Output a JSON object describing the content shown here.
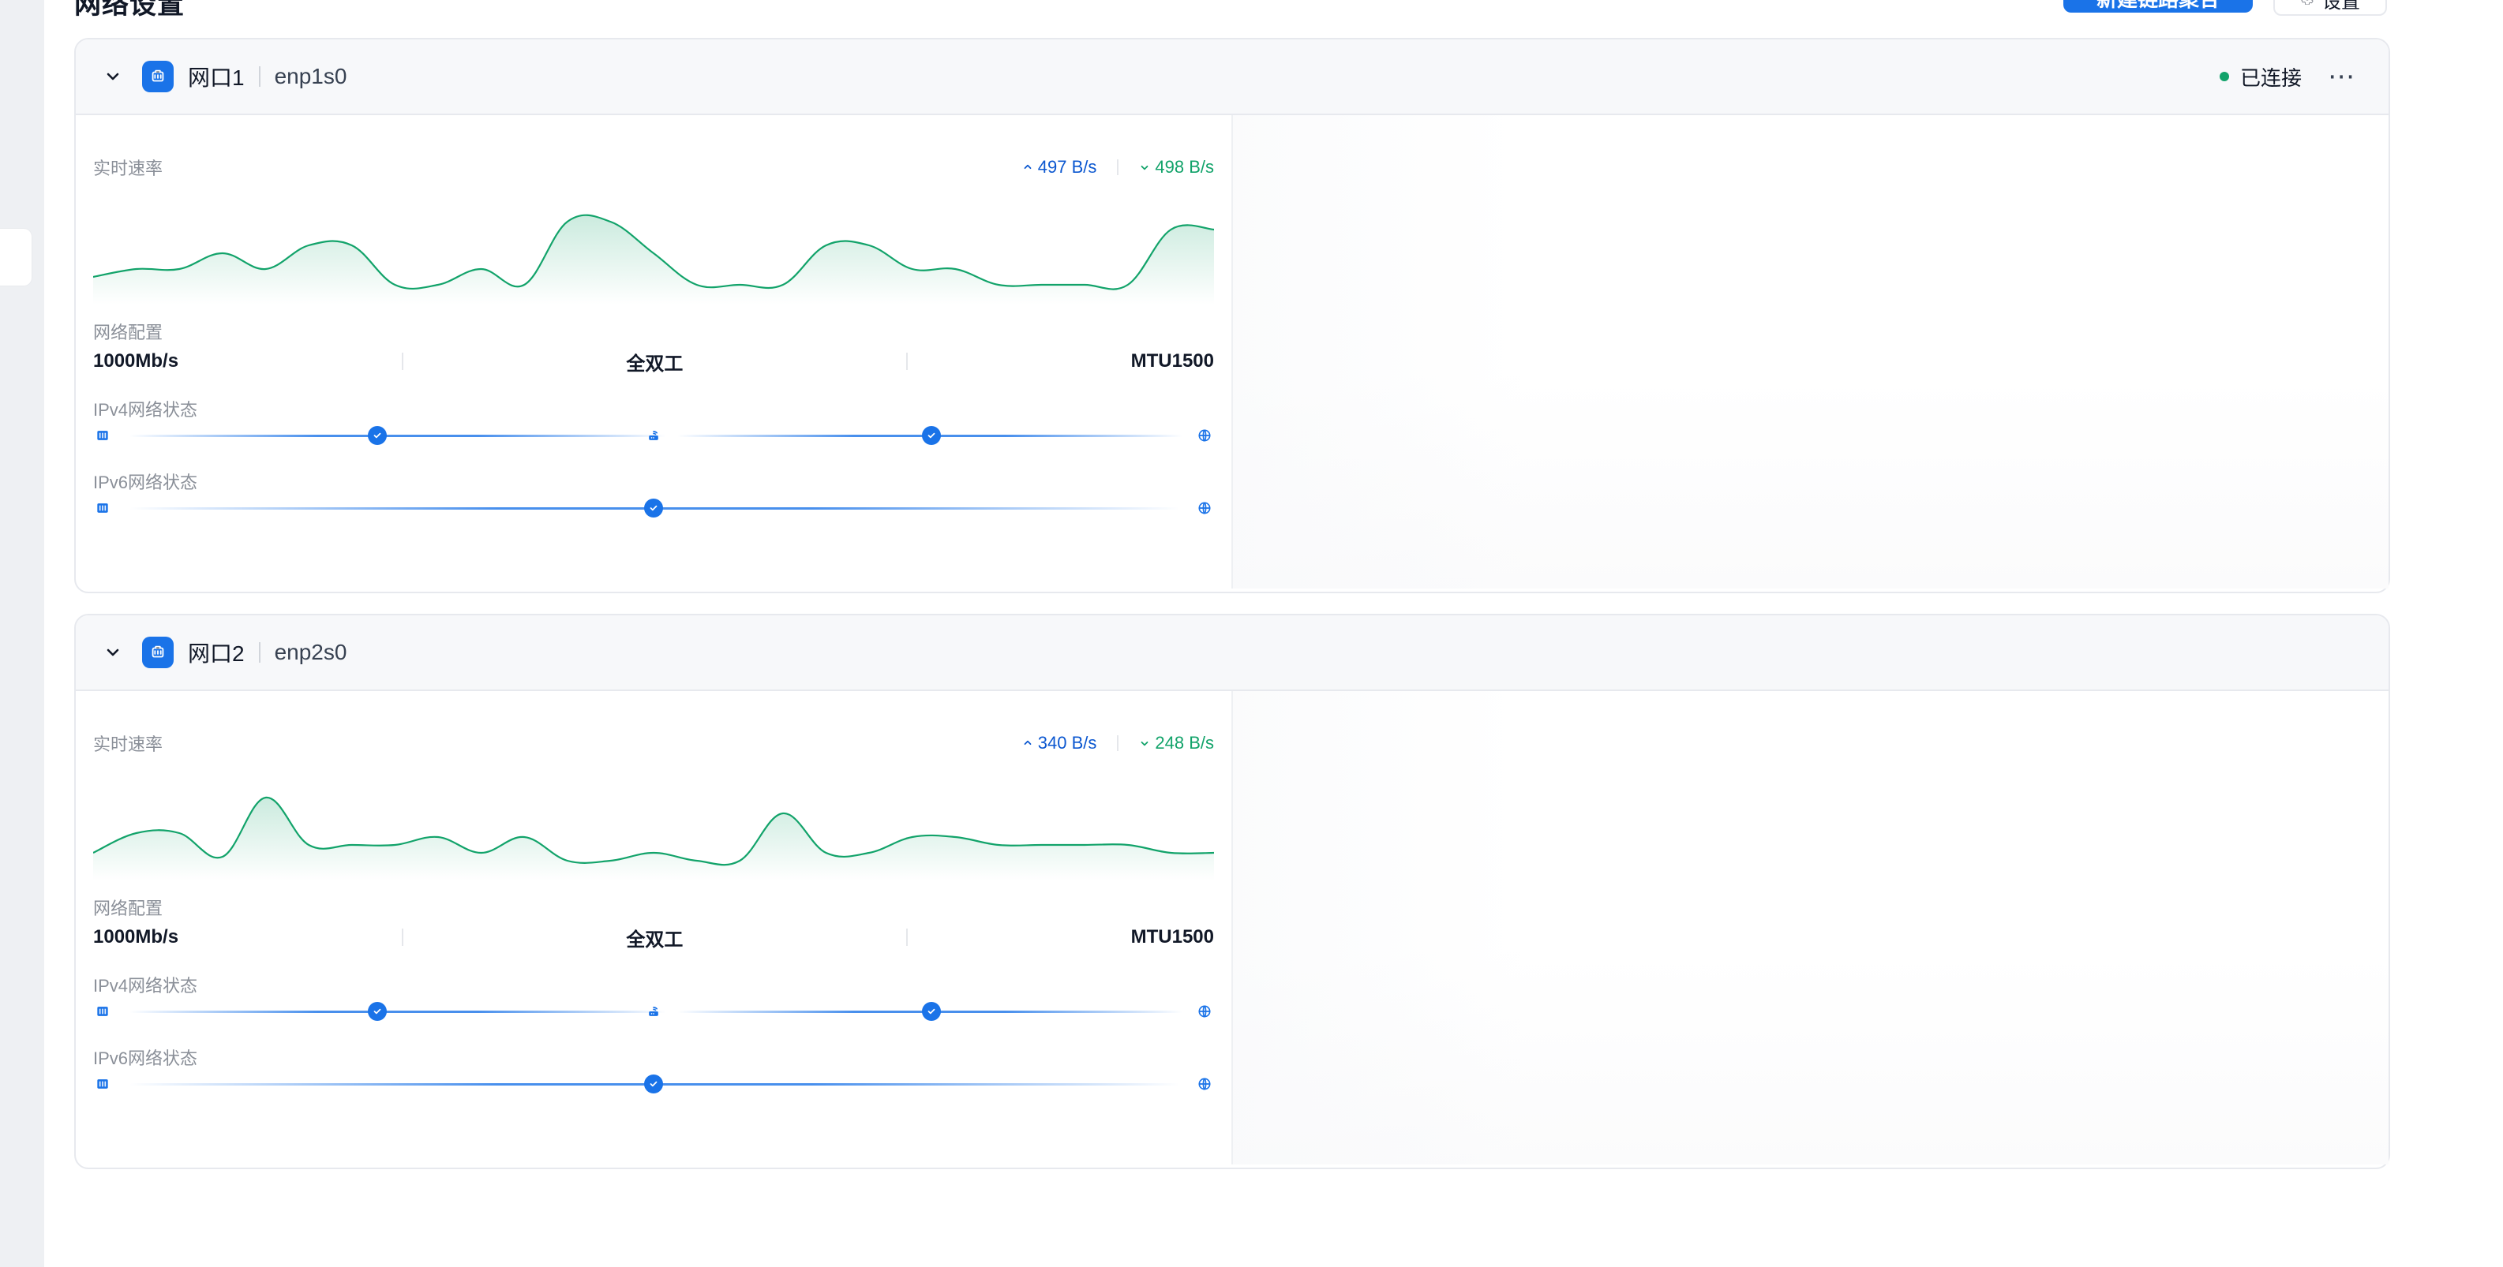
{
  "header": {
    "page_title": "网络设置",
    "primary_button": "新建链路聚合",
    "secondary_button": "设置"
  },
  "ports": [
    {
      "name": "网口1",
      "device": "enp1s0",
      "status": "已连接",
      "realtime_label": "实时速率",
      "up_speed": "497 B/s",
      "down_speed": "498 B/s",
      "net_config_label": "网络配置",
      "speed_mode": "1000Mb/s",
      "duplex": "全双工",
      "mtu": "MTU1500",
      "ipv4_label": "IPv4网络状态",
      "ipv6_label": "IPv6网络状态",
      "chart_series": [
        0.25,
        0.35,
        0.35,
        0.55,
        0.35,
        0.65,
        0.65,
        0.15,
        0.15,
        0.35,
        0.15,
        0.95,
        0.95,
        0.55,
        0.15,
        0.15,
        0.15,
        0.65,
        0.65,
        0.35,
        0.35,
        0.15,
        0.15,
        0.15,
        0.15,
        0.85,
        0.85
      ]
    },
    {
      "name": "网口2",
      "device": "enp2s0",
      "status": "",
      "realtime_label": "实时速率",
      "up_speed": "340 B/s",
      "down_speed": "248 B/s",
      "net_config_label": "网络配置",
      "speed_mode": "1000Mb/s",
      "duplex": "全双工",
      "mtu": "MTU1500",
      "ipv4_label": "IPv4网络状态",
      "ipv6_label": "IPv6网络状态",
      "chart_series": [
        0.25,
        0.5,
        0.5,
        0.2,
        0.95,
        0.35,
        0.35,
        0.35,
        0.45,
        0.25,
        0.45,
        0.15,
        0.15,
        0.25,
        0.15,
        0.15,
        0.75,
        0.25,
        0.25,
        0.45,
        0.45,
        0.35,
        0.35,
        0.35,
        0.35,
        0.25,
        0.25
      ]
    }
  ],
  "colors": {
    "accent_blue": "#1a73e8",
    "status_green": "#12a36a",
    "chart_green": "#12a36a"
  }
}
